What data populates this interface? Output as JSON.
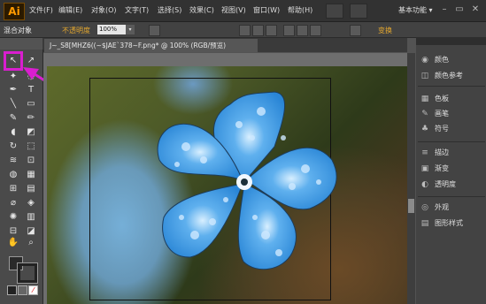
{
  "app": {
    "logo": "Ai",
    "workspace": "基本功能 ▾"
  },
  "menu": [
    "文件(F)",
    "编辑(E)",
    "对象(O)",
    "文字(T)",
    "选择(S)",
    "效果(C)",
    "视图(V)",
    "窗口(W)",
    "帮助(H)"
  ],
  "window_controls": {
    "minimize": "–",
    "maximize": "▭",
    "close": "✕"
  },
  "control_bar": {
    "mixed_objects": "混合对象",
    "opacity_label": "不透明度",
    "opacity_value": "100%",
    "dropdown": "▾",
    "transform_label": "变换"
  },
  "document": {
    "tab_title": "J~_S8[MHZ6((~$JAE`378~F.png* @ 100% (RGB/预览)"
  },
  "panels": [
    {
      "label": "颜色",
      "icon": "color-icon",
      "glyph": "◉"
    },
    {
      "label": "颜色参考",
      "icon": "color-guide-icon",
      "glyph": "◫"
    },
    {
      "label": "色板",
      "icon": "swatches-icon",
      "glyph": "▦"
    },
    {
      "label": "画笔",
      "icon": "brushes-icon",
      "glyph": "✎"
    },
    {
      "label": "符号",
      "icon": "symbols-icon",
      "glyph": "♣"
    },
    {
      "label": "描边",
      "icon": "stroke-icon",
      "glyph": "≡"
    },
    {
      "label": "渐变",
      "icon": "gradient-icon",
      "glyph": "▣"
    },
    {
      "label": "透明度",
      "icon": "transparency-icon",
      "glyph": "◐"
    },
    {
      "label": "外观",
      "icon": "appearance-icon",
      "glyph": "◎"
    },
    {
      "label": "图形样式",
      "icon": "graphic-styles-icon",
      "glyph": "▤"
    }
  ],
  "colors": {
    "highlight": "#d91ecf",
    "menubar": "#323232",
    "accent_text": "#e3a72f",
    "petal": "#3e9ae0"
  }
}
